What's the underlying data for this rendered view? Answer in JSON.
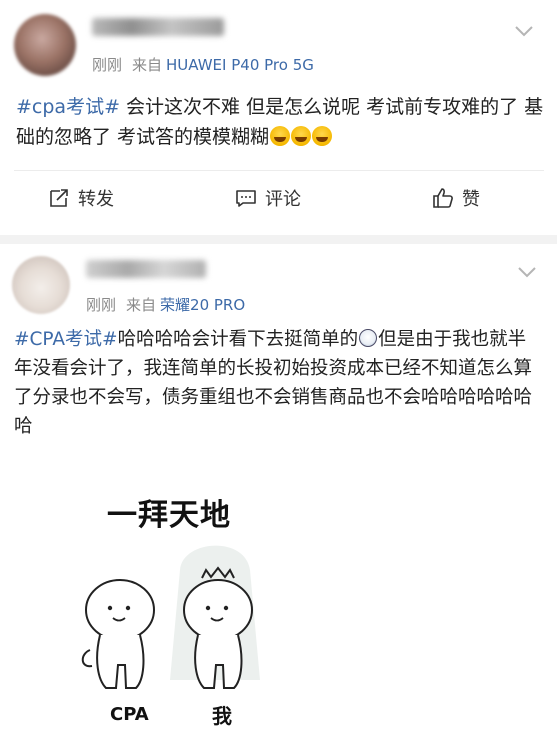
{
  "posts": [
    {
      "time": "刚刚",
      "source_prefix": "来自",
      "device": "HUAWEI P40 Pro 5G",
      "hashtag": "#cpa考试#",
      "text": "会计这次不难  但是怎么说呢  考试前专攻难的了 基础的忽略了  考试答的模模糊糊",
      "emoji_icons": [
        "laugh-cry-emoji-icon",
        "laugh-cry-emoji-icon",
        "laugh-cry-emoji-icon"
      ],
      "actions": {
        "repost": "转发",
        "comment": "评论",
        "like": "赞"
      }
    },
    {
      "time": "刚刚",
      "source_prefix": "来自",
      "device": "荣耀20 PRO",
      "hashtag": "#CPA考试#",
      "text_before_emoji": "哈哈哈哈会计看下去挺简单的",
      "text_after_emoji": "但是由于我也就半年没看会计了，我连简单的长投初始投资成本已经不知道怎么算了分录也不会写，债务重组也不会销售商品也不会哈哈哈哈哈哈哈",
      "emoji_icon": "dizzy-face-emoji-icon",
      "image": {
        "title": "一拜天地",
        "left_label": "CPA",
        "right_label": "我"
      }
    }
  ],
  "icons": {
    "chevron": "chevron-down-icon",
    "repost": "repost-icon",
    "comment": "comment-icon",
    "like": "thumbs-up-icon"
  },
  "colors": {
    "link": "#3d6aa8",
    "meta": "#8a8a8a",
    "divider": "#ececec",
    "gap": "#f2f2f2"
  }
}
